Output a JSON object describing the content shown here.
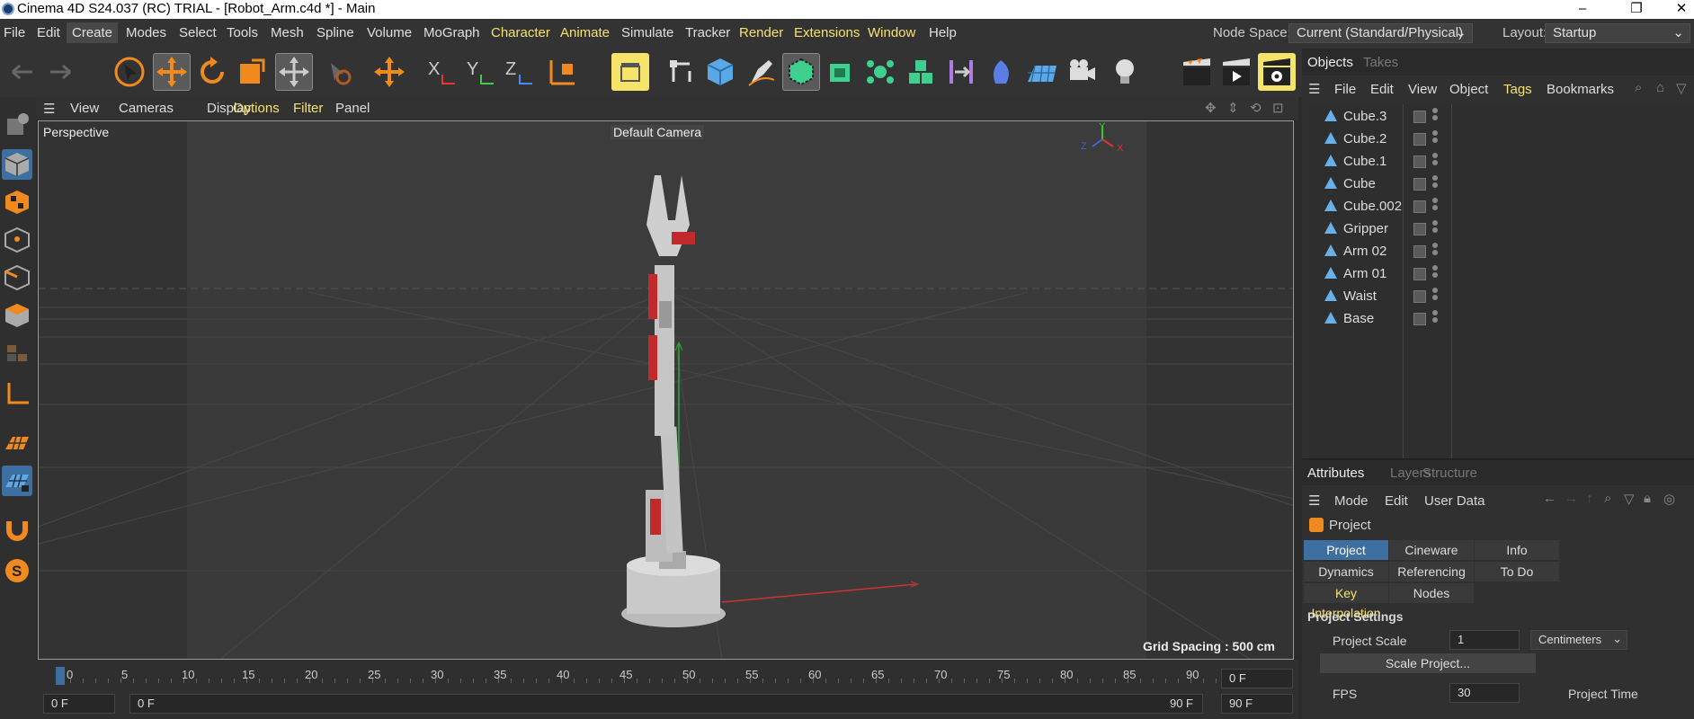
{
  "window": {
    "title": "Cinema 4D S24.037 (RC) TRIAL - [Robot_Arm.c4d *] - Main",
    "min": "–",
    "max": "❐",
    "close": "✕"
  },
  "menu": {
    "items": [
      {
        "label": "File"
      },
      {
        "label": "Edit"
      },
      {
        "label": "Create"
      },
      {
        "label": "Modes"
      },
      {
        "label": "Select"
      },
      {
        "label": "Tools"
      },
      {
        "label": "Mesh"
      },
      {
        "label": "Spline"
      },
      {
        "label": "Volume"
      },
      {
        "label": "MoGraph"
      },
      {
        "label": "Character"
      },
      {
        "label": "Animate"
      },
      {
        "label": "Simulate"
      },
      {
        "label": "Tracker"
      },
      {
        "label": "Render"
      },
      {
        "label": "Extensions"
      },
      {
        "label": "Window"
      },
      {
        "label": "Help"
      }
    ],
    "node_space_label": "Node Space:",
    "node_space_value": "Current (Standard/Physical)",
    "layout_label": "Layout:",
    "layout_value": "Startup"
  },
  "viewport": {
    "menu": [
      "View",
      "Cameras",
      "Display",
      "Options",
      "Filter",
      "Panel"
    ],
    "label": "Perspective",
    "camera": "Default Camera",
    "grid_spacing": "Grid Spacing : 500 cm",
    "axis_x": "X",
    "axis_y": "Y",
    "axis_z": "Z"
  },
  "timeline": {
    "ticks": [
      "0",
      "5",
      "10",
      "15",
      "20",
      "25",
      "30",
      "35",
      "40",
      "45",
      "50",
      "55",
      "60",
      "65",
      "70",
      "75",
      "80",
      "85",
      "90"
    ],
    "current_frame": "0 F",
    "start_frame": "0 F",
    "range_start": "0 F",
    "range_end": "90 F",
    "end_frame": "90 F"
  },
  "objects_panel": {
    "tabs": [
      "Objects",
      "Takes"
    ],
    "menu": [
      "File",
      "Edit",
      "View",
      "Object",
      "Tags",
      "Bookmarks"
    ],
    "objects": [
      {
        "name": "Cube.3"
      },
      {
        "name": "Cube.2"
      },
      {
        "name": "Cube.1"
      },
      {
        "name": "Cube"
      },
      {
        "name": "Cube.002"
      },
      {
        "name": "Gripper"
      },
      {
        "name": "Arm 02"
      },
      {
        "name": "Arm 01"
      },
      {
        "name": "Waist"
      },
      {
        "name": "Base"
      }
    ]
  },
  "attributes_panel": {
    "tabs": [
      "Attributes",
      "Layers",
      "Structure"
    ],
    "menu": [
      "Mode",
      "Edit",
      "User Data"
    ],
    "object_label": "Project",
    "buttons": [
      {
        "label": "Project Settings"
      },
      {
        "label": "Cineware"
      },
      {
        "label": "Info"
      },
      {
        "label": "Dynamics"
      },
      {
        "label": "Referencing"
      },
      {
        "label": "To Do"
      },
      {
        "label": "Key Interpolation"
      },
      {
        "label": "Nodes"
      }
    ],
    "section_title": "Project Settings",
    "project_scale_label": "Project Scale",
    "project_scale_value": "1",
    "project_scale_unit": "Centimeters",
    "scale_project_button": "Scale Project...",
    "fps_label": "FPS",
    "fps_value": "30",
    "project_time_label": "Project Time"
  }
}
